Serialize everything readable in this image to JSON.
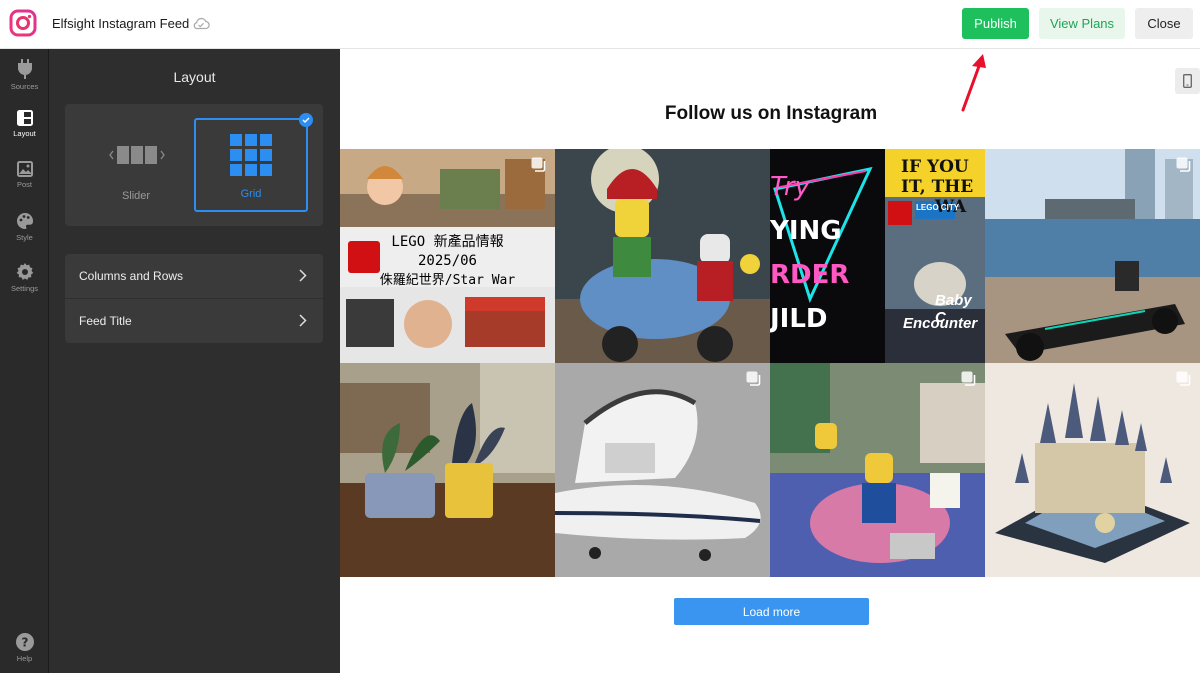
{
  "app": {
    "title": "Elfsight Instagram Feed"
  },
  "toolbar": {
    "publish_label": "Publish",
    "plans_label": "View Plans",
    "close_label": "Close"
  },
  "rail": {
    "sources": "Sources",
    "layout": "Layout",
    "post": "Post",
    "style": "Style",
    "settings": "Settings",
    "help": "Help"
  },
  "panel": {
    "title": "Layout",
    "slider_label": "Slider",
    "grid_label": "Grid",
    "selected": "Grid",
    "menu": [
      {
        "label": "Columns and Rows"
      },
      {
        "label": "Feed Title"
      }
    ]
  },
  "preview": {
    "feed_title": "Follow us on Instagram",
    "load_more_label": "Load more",
    "tile1": {
      "line1": "LEGO 新產品情報",
      "line2": "2025/06",
      "line3": "侏羅紀世界/Star War"
    },
    "tile3": {
      "left": [
        "Try",
        "YING",
        "RDER",
        "JILD"
      ],
      "right": [
        "IF YOU",
        "IT, THE",
        "WA"
      ],
      "badge": "LEGO CITY",
      "caption1": "Baby C",
      "caption2": "Encounter"
    }
  },
  "colors": {
    "accent": "#2b8ef0",
    "publish": "#1ec05d",
    "sidebar": "#2a2a2a",
    "panel": "#2e2e2e",
    "arrow": "#e8102a"
  }
}
